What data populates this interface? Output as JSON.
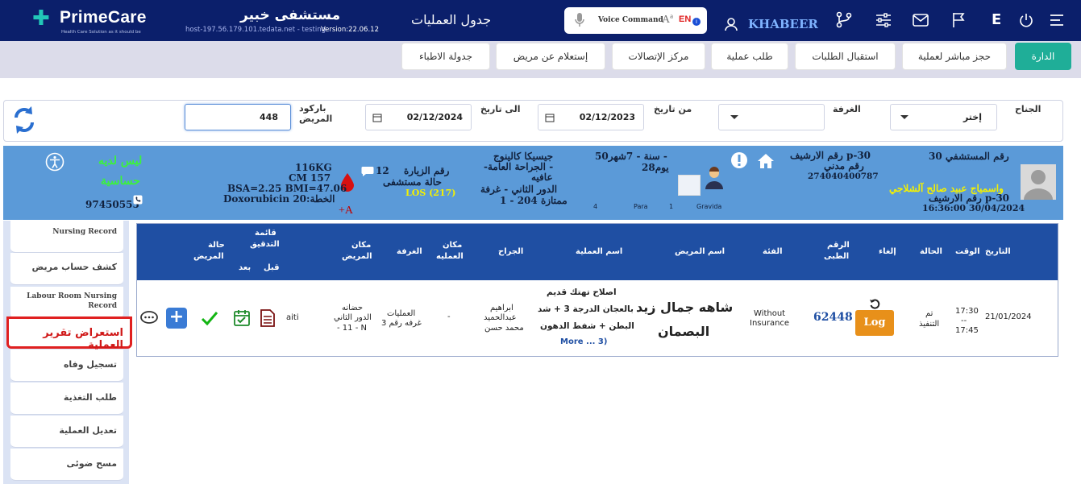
{
  "brand": {
    "name": "PrimeCare",
    "tagline": "Health Care Solution as it should be"
  },
  "header": {
    "hospital": "مستشفى خبير",
    "host": "host-197.56.179.101.tedata.net - testing",
    "version": "Version:22.06.12",
    "page_title": "جدول العمليات",
    "voice_command": "Voice Command",
    "lang_label": "EN",
    "user": "KHABEER",
    "e_label": "E"
  },
  "tabs": [
    {
      "label": "الدارة",
      "active": true
    },
    {
      "label": "حجز مباشر لعملية"
    },
    {
      "label": "استقبال الطلبات"
    },
    {
      "label": "طلب عملية"
    },
    {
      "label": "مركز الإتصالات"
    },
    {
      "label": "إستعلام عن مريض"
    },
    {
      "label": "جدولة الاطباء"
    }
  ],
  "filters": {
    "ward_label": "الجناح",
    "ward_value": "إختر",
    "room_label": "الغرفة",
    "from_label": "من تاريخ",
    "from_value": "02/12/2023",
    "to_label": "الى تاريخ",
    "to_value": "02/12/2024",
    "barcode_label_1": "باركود",
    "barcode_label_2": "المريض",
    "barcode_value": "448"
  },
  "patient": {
    "hospital_no": "رقم المستشفي 30",
    "name": "واسمياج عبيد صالح آلشلاجي",
    "archive_no": "رقم الارشيف p-30",
    "archive_time": "16:36:00 30/04/2024",
    "archive_label": "رقم الارشيف p-30",
    "civil_label": "رقم مدني",
    "civil_no": "274040400787",
    "age": "50سنة - 7شهر -",
    "days": "28يوم",
    "doctor_line1": "جيسيكا كالينوج",
    "doctor_line2": "-الجراحة العامة -",
    "doctor_line3": "عافيه",
    "doctor_line4": "الدور الثاني - غرفة",
    "doctor_line5": "ممتازة 204 - 1",
    "gravida_label": "Gravida",
    "gravida_value": "1",
    "para_label": "Para",
    "para_value": "4",
    "visit_label": "رقم الزيارة",
    "visit_state": "حالة مستشفى",
    "los": "LOS (217)",
    "msg_count": "12",
    "blood": "+A",
    "weight": "116KG",
    "height": "CM 157",
    "bsa": "BSA=2.25 BMI=47.06",
    "plan": "Doxorubicin 20:الخطة",
    "allergy_1": "ليس لديه",
    "allergy_2": "حساسية",
    "phone": "97450555"
  },
  "sidebar": [
    {
      "label": "Nursing Record"
    },
    {
      "label": "كشف حساب مريض"
    },
    {
      "label": "Labour Room Nursing Record"
    },
    {
      "label": "استعراض تقرير العملية",
      "highlight": true
    },
    {
      "label": "تسجيل وفاه"
    },
    {
      "label": "طلب التغذية"
    },
    {
      "label": "تعديل العملية"
    },
    {
      "label": "مسح ضوئى"
    }
  ],
  "table": {
    "headers": {
      "date": "التاريخ",
      "time": "الوقت",
      "status": "الحالة",
      "cancel": "إلغاء",
      "medical_no_1": "الرقم",
      "medical_no_2": "الطبى",
      "category": "الفئة",
      "patient_name": "اسم المريض",
      "operation_name": "اسم العملية",
      "surgeon": "الجراح",
      "op_place_1": "مكان",
      "op_place_2": "العمليه",
      "room": "الغرفة",
      "patient_place_1": "مكان",
      "patient_place_2": "المريض",
      "checklist_1": "قائمة",
      "checklist_2": "التدقيق",
      "before": "قبل",
      "after": "بعد",
      "patient_state_1": "حالة",
      "patient_state_2": "المريض"
    },
    "rows": [
      {
        "date": "21/01/2024",
        "time_from": "17:30",
        "time_sep": "--",
        "time_to": "17:45",
        "status_1": "تم",
        "status_2": "التنفيذ",
        "log": "Log",
        "medical_no": "62448",
        "category_1": "Without",
        "category_2": "Insurance",
        "patient_name_1": "شاهه جمال زيد",
        "patient_name_2": "البصمان",
        "operation_1": "اصلاح تهتك قديم",
        "operation_2": "بالعجان الدرجة 3 + شد",
        "operation_3": "البطن + شفط الدهون",
        "operation_more": "More ... 3)",
        "surgeon_1": "ابراهيم",
        "surgeon_2": "عبدالحميد",
        "surgeon_3": "محمد حسن",
        "op_place": "-",
        "room_1": "العمليات",
        "room_2": "غرفه رقم 3",
        "patient_place_1": "حضانه",
        "patient_place_2": "الدور الثاني",
        "patient_place_3": "- 11 - N",
        "extra": "aiti"
      }
    ]
  },
  "colors": {
    "top_bar": "#0b1f6b",
    "active_tab": "#1fae98",
    "patient_band": "#5b9ad8",
    "table_header": "#1f4fa3",
    "log_button": "#e8901a",
    "highlight": "#e02020"
  }
}
